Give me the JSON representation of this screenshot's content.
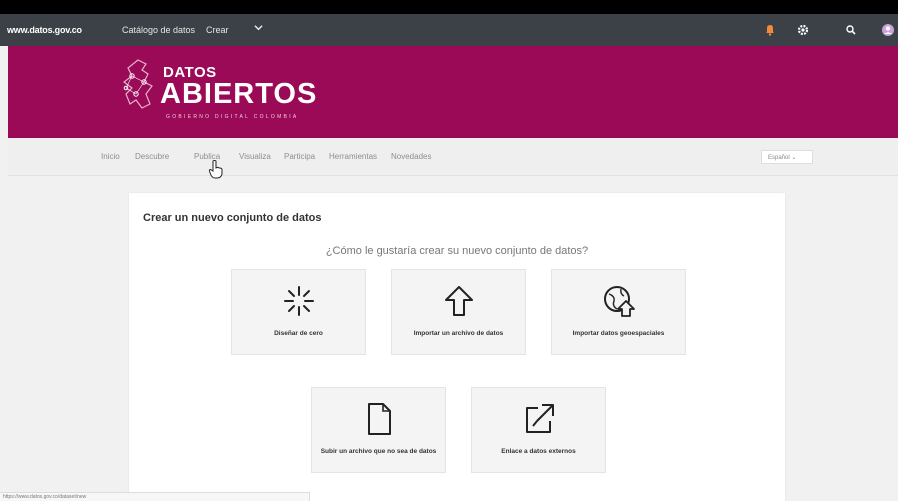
{
  "topbar": {
    "site": "www.datos.gov.co",
    "nav": [
      "Catálogo de datos",
      "Crear"
    ],
    "icons": [
      "notification-icon",
      "gear-icon",
      "search-icon",
      "avatar"
    ]
  },
  "logo": {
    "line1": "DATOS",
    "line2": "ABIERTOS",
    "line3": "GOBIERNO DIGITAL COLOMBIA"
  },
  "nav": {
    "items": [
      "Inicio",
      "Descubre",
      "Publica",
      "Visualiza",
      "Participa",
      "Herramientas",
      "Novedades"
    ],
    "language": "Español"
  },
  "panel": {
    "title": "Crear un nuevo conjunto de datos",
    "question": "¿Cómo le gustaría crear su nuevo conjunto de datos?",
    "options": [
      {
        "label": "Diseñar de cero",
        "icon": "sparkle-icon"
      },
      {
        "label": "Importar un archivo de datos",
        "icon": "upload-arrow-icon"
      },
      {
        "label": "Importar datos geoespaciales",
        "icon": "globe-upload-icon"
      },
      {
        "label": "Subir un archivo que no sea de datos",
        "icon": "file-icon"
      },
      {
        "label": "Enlace a datos externos",
        "icon": "external-link-icon"
      }
    ]
  },
  "status": {
    "url": "https://www.datos.gov.co/dataset/new"
  },
  "colors": {
    "brand": "#9a0a57",
    "topbar": "#3c4148",
    "card": "#f4f4f4"
  }
}
